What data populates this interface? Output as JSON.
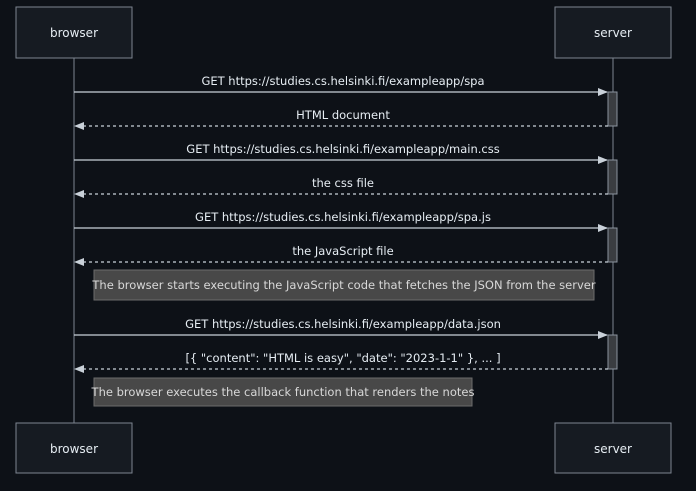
{
  "actors": {
    "browser": "browser",
    "server": "server"
  },
  "messages": [
    {
      "from": "browser",
      "to": "server",
      "style": "solid",
      "label": "GET https://studies.cs.helsinki.fi/exampleapp/spa"
    },
    {
      "from": "server",
      "to": "browser",
      "style": "dotted",
      "label": "HTML document"
    },
    {
      "from": "browser",
      "to": "server",
      "style": "solid",
      "label": "GET https://studies.cs.helsinki.fi/exampleapp/main.css"
    },
    {
      "from": "server",
      "to": "browser",
      "style": "dotted",
      "label": "the css file"
    },
    {
      "from": "browser",
      "to": "server",
      "style": "solid",
      "label": "GET https://studies.cs.helsinki.fi/exampleapp/spa.js"
    },
    {
      "from": "server",
      "to": "browser",
      "style": "dotted",
      "label": "the JavaScript file"
    },
    {
      "from": "browser",
      "to": "server",
      "style": "solid",
      "label": "GET https://studies.cs.helsinki.fi/exampleapp/data.json"
    },
    {
      "from": "server",
      "to": "browser",
      "style": "dotted",
      "label": "[{ \"content\": \"HTML is easy\", \"date\": \"2023-1-1\" }, ... ]"
    }
  ],
  "notes": [
    {
      "text": "The browser starts executing the JavaScript code that fetches the JSON from the server"
    },
    {
      "text": "The browser executes the callback function that renders the notes"
    }
  ]
}
